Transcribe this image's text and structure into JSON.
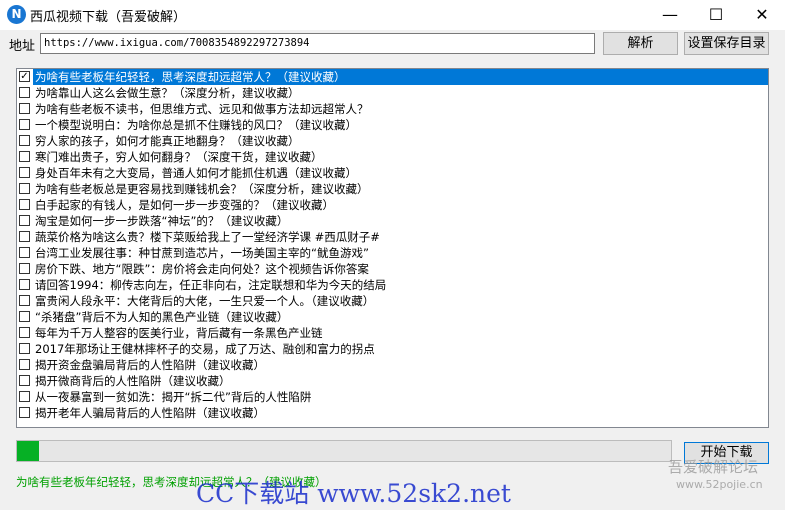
{
  "window": {
    "title": "西瓜视频下载（吾爱破解）",
    "app_icon_letter": "N",
    "min_glyph": "—",
    "max_glyph": "☐",
    "close_glyph": "✕"
  },
  "address": {
    "label": "地址",
    "value": "https://www.ixigua.com/7008354892297273894"
  },
  "buttons": {
    "parse": "解析",
    "set_dir": "设置保存目录",
    "start": "开始下载"
  },
  "videos": [
    {
      "title": "为啥有些老板年纪轻轻，思考深度却远超常人？（建议收藏）",
      "checked": true,
      "selected": true
    },
    {
      "title": "为啥靠山人这么会做生意？（深度分析，建议收藏）",
      "checked": false
    },
    {
      "title": "为啥有些老板不读书，但思维方式、远见和做事方法却远超常人？",
      "checked": false
    },
    {
      "title": "一个模型说明白：为啥你总是抓不住赚钱的风口？（建议收藏）",
      "checked": false
    },
    {
      "title": "穷人家的孩子，如何才能真正地翻身？（建议收藏）",
      "checked": false
    },
    {
      "title": "寒门难出贵子，穷人如何翻身？（深度干货，建议收藏）",
      "checked": false
    },
    {
      "title": "身处百年未有之大变局，普通人如何才能抓住机遇（建议收藏）",
      "checked": false
    },
    {
      "title": "为啥有些老板总是更容易找到赚钱机会？（深度分析，建议收藏）",
      "checked": false
    },
    {
      "title": "白手起家的有钱人，是如何一步一步变强的？（建议收藏）",
      "checked": false
    },
    {
      "title": "淘宝是如何一步一步跌落“神坛”的？（建议收藏）",
      "checked": false
    },
    {
      "title": "蔬菜价格为啥这么贵？楼下菜贩给我上了一堂经济学课 #西瓜财子#",
      "checked": false
    },
    {
      "title": "台湾工业发展往事：种甘蔗到造芯片，一场美国主宰的“鱿鱼游戏”",
      "checked": false
    },
    {
      "title": "房价下跌、地方“限跌”：房价将会走向何处？这个视频告诉你答案",
      "checked": false
    },
    {
      "title": "请回答1994：柳传志向左，任正非向右，注定联想和华为今天的结局",
      "checked": false
    },
    {
      "title": "富贵闲人段永平：大佬背后的大佬，一生只爱一个人。（建议收藏）",
      "checked": false
    },
    {
      "title": "“杀猪盘”背后不为人知的黑色产业链（建议收藏）",
      "checked": false
    },
    {
      "title": "每年为千万人整容的医美行业，背后藏有一条黑色产业链",
      "checked": false
    },
    {
      "title": "2017年那场让王健林摔杯子的交易，成了万达、融创和富力的拐点",
      "checked": false
    },
    {
      "title": "揭开资金盘骗局背后的人性陷阱（建议收藏）",
      "checked": false
    },
    {
      "title": "揭开微商背后的人性陷阱（建议收藏）",
      "checked": false
    },
    {
      "title": "从一夜暴富到一贫如洗：揭开“拆二代”背后的人性陷阱",
      "checked": false
    },
    {
      "title": "揭开老年人骗局背后的人性陷阱（建议收藏）",
      "checked": false
    }
  ],
  "progress": {
    "fraction": 0.034
  },
  "status": {
    "text": "为啥有些老板年纪轻轻，思考深度却远超常人？（建议收藏）"
  },
  "watermark": {
    "site_cn": "CC下载站 www.52sk2.net",
    "forum_name": "吾爱破解论坛",
    "forum_url": "www.52pojie.cn"
  },
  "colors": {
    "selection": "#0078d7",
    "progress": "#06b025",
    "status": "#00a000"
  }
}
